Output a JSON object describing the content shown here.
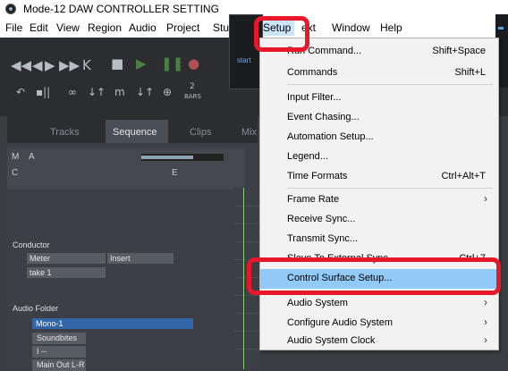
{
  "window": {
    "title": "Mode-12 DAW CONTROLLER SETTING"
  },
  "menubar": {
    "items": [
      "File",
      "Edit",
      "View",
      "Region",
      "Audio",
      "Project",
      "Studi",
      "Setup",
      "ext",
      "Window",
      "Help"
    ]
  },
  "toolbar": {
    "glyphs": [
      "◀◀",
      "◀",
      "▶",
      "▶▶",
      "K",
      "■",
      "▶",
      "❚❚",
      "●"
    ],
    "row2": [
      "↶",
      "▪||",
      "∞",
      "↓↑",
      "m",
      "↓↑",
      "⊕"
    ],
    "bars_top": "2",
    "bars_label": "BARS",
    "counter_label": "start"
  },
  "tracks": {
    "tabs": [
      "Tracks",
      "Sequence",
      "Clips",
      "Mix"
    ],
    "header": {
      "m": "M",
      "a": "A",
      "c": "C",
      "e": "E"
    },
    "conductor": {
      "label": "Conductor",
      "meter": "Meter",
      "insert": "Insert",
      "take": "take 1"
    },
    "folder": {
      "label": "Audio Folder",
      "track": "Mono-1",
      "input": "Soundbites",
      "i": "I --",
      "output": "Main Out L-R"
    }
  },
  "setup_menu": {
    "items": [
      {
        "label": "Run Command...",
        "shortcut": "Shift+Space"
      },
      {
        "label": "Commands",
        "shortcut": "Shift+L"
      },
      {
        "label": "Input Filter...",
        "shortcut": ""
      },
      {
        "label": "Event Chasing...",
        "shortcut": ""
      },
      {
        "label": "Automation Setup...",
        "shortcut": ""
      },
      {
        "label": "Legend...",
        "shortcut": ""
      },
      {
        "label": "Time Formats",
        "shortcut": "Ctrl+Alt+T"
      },
      {
        "label": "Frame Rate",
        "shortcut": "",
        "submenu": true
      },
      {
        "label": "Receive Sync...",
        "shortcut": ""
      },
      {
        "label": "Transmit Sync...",
        "shortcut": ""
      },
      {
        "label": "Slave To External Sync",
        "shortcut": "Ctrl+7"
      },
      {
        "label": "Control Surface Setup...",
        "shortcut": "",
        "highlighted": true
      },
      {
        "label": "Audio System",
        "shortcut": "",
        "submenu": true
      },
      {
        "label": "Configure Audio System",
        "shortcut": "",
        "submenu": true
      },
      {
        "label": "Audio System Clock",
        "shortcut": "",
        "submenu": true
      }
    ]
  },
  "colors": {
    "callout": "#e8182a",
    "highlight": "#91c9f7",
    "accent": "#3266a8"
  }
}
